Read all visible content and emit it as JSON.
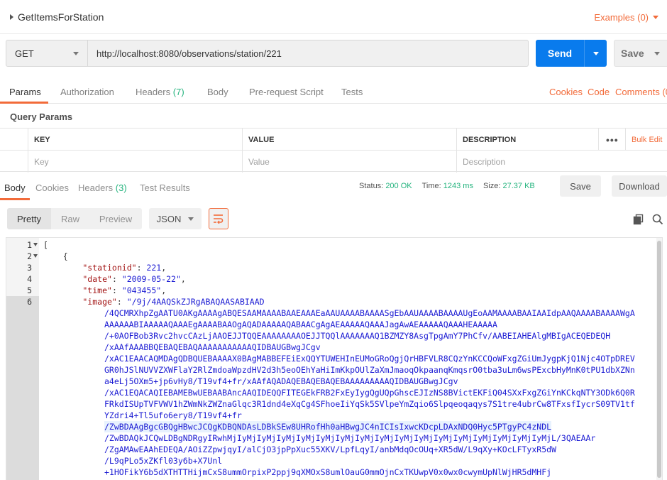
{
  "request": {
    "name": "GetItemsForStation",
    "examples_label": "Examples (0)"
  },
  "urlbar": {
    "method": "GET",
    "url": "http://localhost:8080/observations/station/221",
    "send_label": "Send",
    "save_label": "Save"
  },
  "request_tabs": {
    "params": "Params",
    "authorization": "Authorization",
    "headers": "Headers",
    "headers_count": "(7)",
    "body": "Body",
    "prerequest": "Pre-request Script",
    "tests": "Tests",
    "cookies": "Cookies",
    "code": "Code",
    "comments": "Comments (0"
  },
  "query_params": {
    "title": "Query Params",
    "columns": [
      "KEY",
      "VALUE",
      "DESCRIPTION"
    ],
    "bulk_edit": "Bulk Edit",
    "placeholders": {
      "key": "Key",
      "value": "Value",
      "description": "Description"
    }
  },
  "response_tabs": {
    "body": "Body",
    "cookies": "Cookies",
    "headers": "Headers",
    "headers_count": "(3)",
    "test_results": "Test Results"
  },
  "response_status": {
    "status_label": "Status:",
    "status_value": "200 OK",
    "time_label": "Time:",
    "time_value": "1243 ms",
    "size_label": "Size:",
    "size_value": "27.37 KB",
    "save_label": "Save",
    "download_label": "Download"
  },
  "view_toolbar": {
    "pretty": "Pretty",
    "raw": "Raw",
    "preview": "Preview",
    "format": "JSON"
  },
  "colors": {
    "accent": "#f26b3a",
    "send_blue": "#097bed",
    "status_green": "#26b47f"
  },
  "code": {
    "line_numbers": [
      "1",
      "2",
      "3",
      "4",
      "5",
      "6"
    ],
    "lines": [
      "[",
      "    {",
      "        \"stationid\": 221,",
      "        \"date\": \"2009-05-22\",",
      "        \"time\": \"043455\",",
      "        \"image\": \"/9j/4AAQSkZJRgABAQAASABIAAD"
    ],
    "image_continuation": [
      "/4QCMRXhpZgAATU0AKgAAAAgABQESAAMAAAABAAEAAAEaAAUAAAABAAAASgEbAAUAAAABAAAAUgEoAAMAAAABAAIAAIdpAAQAAAABAAAAWgA",
      "AAAAAABIAAAAAQAAAEgAAAABAAOgAQADAAAAAQABAACgAgAEAAAAAQAAAJagAwAEAAAAAQAAAHEAAAAA",
      "/+0AOFBob3Rvc2hvcCAzLjAAOEJJTQQEAAAAAAAAOEJJTQQlAAAAAAAQ1BZMZY8AsgTpgAmY7PhCfv/AABEIAHEAlgMBIgACEQEDEQH",
      "/xAAfAAABBQEBAQEBAQAAAAAAAAAAAQIDBAUGBwgJCgv",
      "/xAC1EAACAQMDAgQDBQUEBAAAAX0BAgMABBEFEiExQQYTUWEHInEUMoGRoQgjQrHBFVLR8CQzYnKCCQoWFxgZGiUmJygpKjQ1Njc4OTpDREV",
      "GR0hJSlNUVVZXWFlaY2RlZmdoaWpzdHV2d3h5eoOEhYaHiImKkpOUlZaXmJmaoqOkpaanqKmqsrO0tba3uLm6wsPExcbHyMnK0tPU1dbXZNn",
      "a4eLj5OXm5+jp6vHy8/T19vf4+fr/xAAfAQADAQEBAQEBAQEBAAAAAAAAAQIDBAUGBwgJCgv",
      "/xAC1EQACAQIEBAMEBwUEBAABAncAAQIDEQQFITEGEkFRB2FxEyIygQgUQpGhscEJIzNS8BVictEKFiQ04SXxFxgZGiYnKCkqNTY3ODk6Q0R",
      "FRkdISUpTVFVWV1hZWmNkZWZnaGlqc3R1dnd4eXqCg4SFhoeIiYqSk5SVlpeYmZqio6Slpqeoqaqys7S1tre4ubrCw8TFxsfIycrS09TV1tf",
      "YZdri4+Tl5ufo6ery8/T19vf4+fr",
      "/ZwBDAAgBgcGBQgHBwcJCQgKDBQNDAsLDBkSEw8UHRofHh0aHBwgJC4nICIsIxwcKDcpLDAxNDQ0Hyc5PTgyPC4zNDL",
      "/ZwBDAQkJCQwLDBgNDRgyIRwhMjIyMjIyMjIyMjIyMjIyMjIyMjIyMjIyMjIyMjIyMjIyMjIyMjIyMjIyMjIyMjIyMjL/3QAEAAr",
      "/ZgAMAwEAAhEDEQA/AOiZZpwjqyI/alCjO3jpPpXuc55XKV/LpfLqyI/anbMdqOcOUq+XR5dW/L9qXy+KOcLFTyxR5dW",
      "/L9qPLo5xZKfl03y6b+X7Unl",
      "+1HOFikY6b5dXTHTTHijmCxS8ummOrpixP2ppj9qXMOxS8umlOauG0mmOjnCxTKUwpV0x0wx0cwymUpNlWjHR5dMHFj"
    ]
  }
}
